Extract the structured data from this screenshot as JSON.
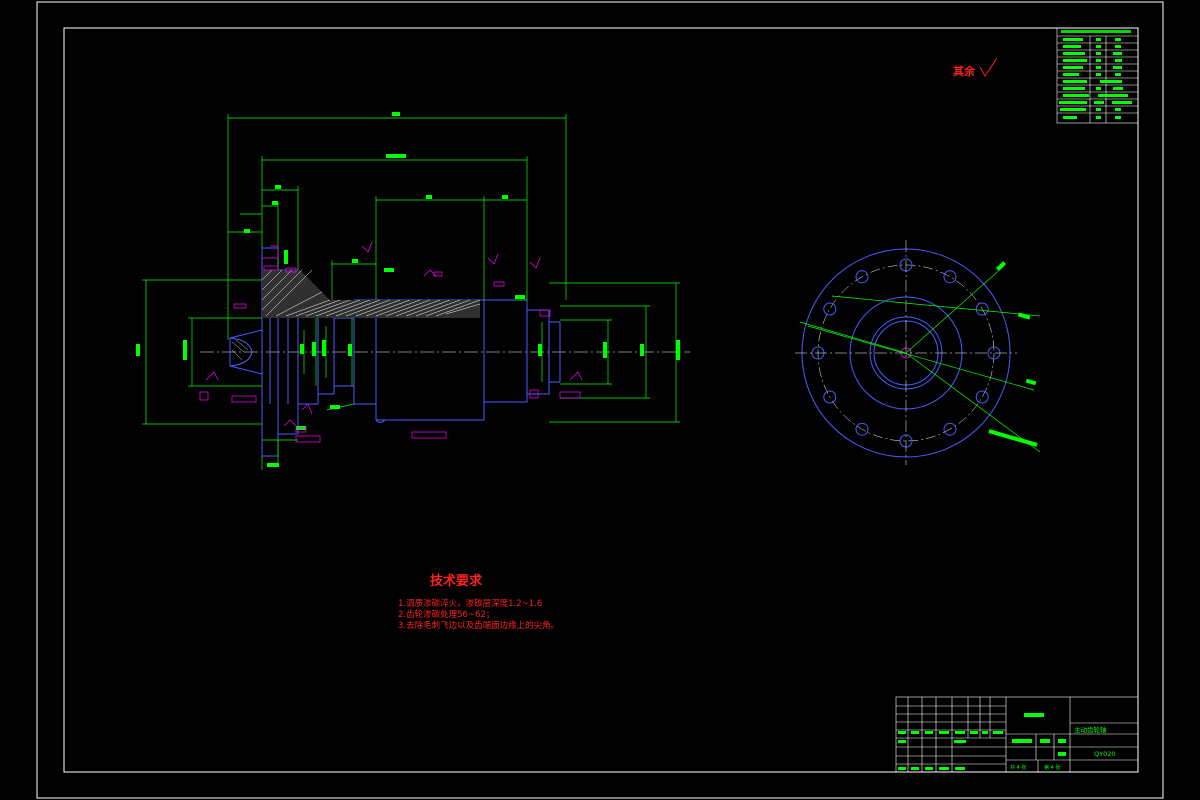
{
  "colors": {
    "background": "#000000",
    "frame": "#ffffff",
    "outline": "#4a5cff",
    "dimension": "#00ff00",
    "annotation": "#ff00ff",
    "notes": "#ff2020",
    "hatch": "#ffffff"
  },
  "surface_finish_note": "其余",
  "technical_requirements": {
    "title": "技术要求",
    "items": [
      "1.调质渗碳淬火，渗碳层深度1.2~1.6",
      "2.齿轮渗碳处理56~62；",
      "3.去除毛刺飞边以及齿端面边缘上的尖角。"
    ]
  },
  "title_block": {
    "part_name": "主动齿轮轴",
    "drawing_no": "QY020",
    "scale_label": "比例",
    "scale": "1:1",
    "sheet_total": "共 4 张",
    "sheet_no": "第 4 张"
  },
  "icons": {
    "surface_finish": "check-symbol-icon",
    "datum": "datum-flag-icon"
  }
}
